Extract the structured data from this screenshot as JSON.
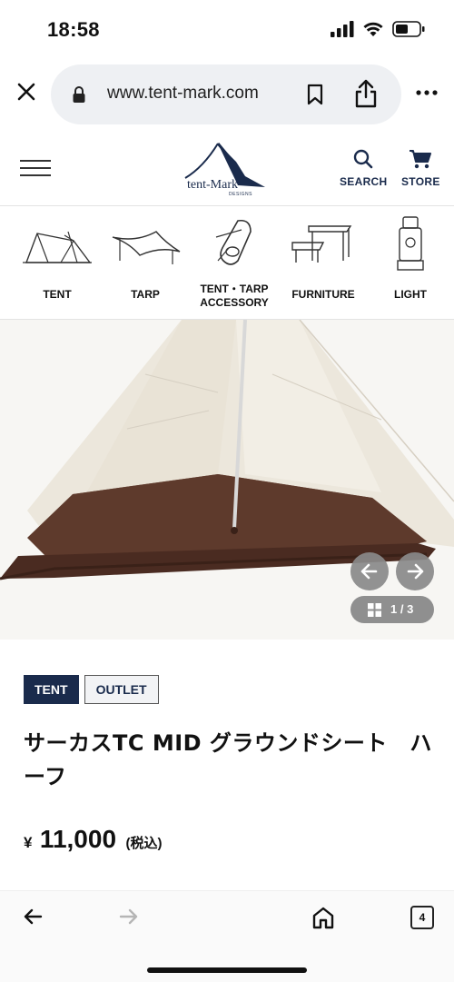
{
  "status_bar": {
    "time": "18:58"
  },
  "browser": {
    "url": "www.tent-mark.com"
  },
  "site_header": {
    "logo_text": "tent-Mark",
    "logo_sub": "DESIGNS",
    "search_label": "SEARCH",
    "store_label": "STORE"
  },
  "categories": [
    {
      "label": "TENT",
      "icon": "tent-icon"
    },
    {
      "label": "TARP",
      "icon": "tarp-icon"
    },
    {
      "label": "TENT・TARP\nACCESSORY",
      "icon": "carabiner-icon"
    },
    {
      "label": "FURNITURE",
      "icon": "furniture-icon"
    },
    {
      "label": "LIGHT",
      "icon": "lantern-icon"
    }
  ],
  "gallery": {
    "counter": "1 / 3"
  },
  "product": {
    "tags": [
      "TENT",
      "OUTLET"
    ],
    "title": "サーカスTC MID グラウンドシート　ハーフ",
    "price_currency": "¥",
    "price_amount": "11,000",
    "price_tax": "(税込)"
  },
  "toolbar": {
    "tabs_count": "4"
  },
  "colors": {
    "brand_navy": "#1a2b4c",
    "sheet_brown": "#5e3a2c",
    "tent_canvas": "#efeae0"
  }
}
